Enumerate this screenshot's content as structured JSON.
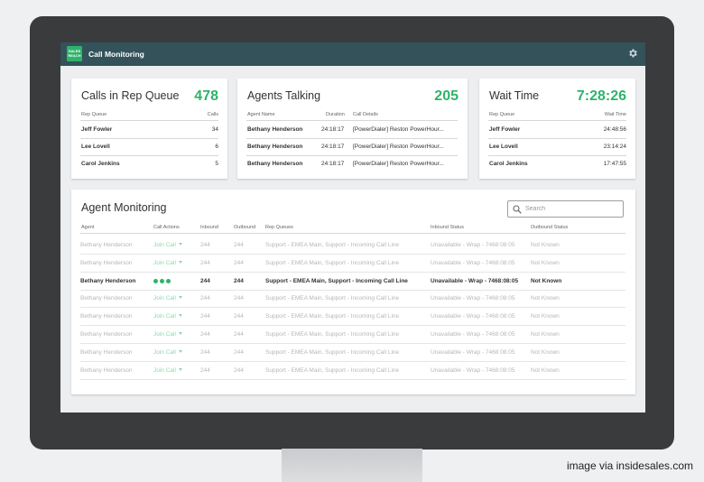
{
  "app": {
    "title": "Call Monitoring",
    "logo_text": "SALES\nREACH"
  },
  "caption": "image via insidesales.com",
  "rep_queue": {
    "title": "Calls in Rep Queue",
    "count": "478",
    "col_queue": "Rep Queue",
    "col_calls": "Calls",
    "rows": [
      {
        "name": "Jeff Fowler",
        "calls": "34"
      },
      {
        "name": "Lee Lovell",
        "calls": "6"
      },
      {
        "name": "Carol Jenkins",
        "calls": "5"
      }
    ]
  },
  "agents_talking": {
    "title": "Agents Talking",
    "count": "205",
    "col_agent": "Agent Name",
    "col_duration": "Duration",
    "col_details": "Call Details",
    "rows": [
      {
        "name": "Bethany Henderson",
        "duration": "24:18:17",
        "details": "[PowerDialer] Reston PowerHour..."
      },
      {
        "name": "Bethany Henderson",
        "duration": "24:18:17",
        "details": "[PowerDialer] Reston PowerHour..."
      },
      {
        "name": "Bethany Henderson",
        "duration": "24:18:17",
        "details": "[PowerDialer] Reston PowerHour..."
      }
    ]
  },
  "wait_time": {
    "title": "Wait Time",
    "value": "7:28:26",
    "col_queue": "Rep Queue",
    "col_wait": "Wait Time",
    "rows": [
      {
        "name": "Jeff Fowler",
        "wait": "24:48:56"
      },
      {
        "name": "Lee Lovell",
        "wait": "23:14:24"
      },
      {
        "name": "Carol Jenkins",
        "wait": "17:47:55"
      }
    ]
  },
  "agent_monitoring": {
    "title": "Agent Monitoring",
    "search_placeholder": "Search",
    "headers": {
      "agent": "Agent",
      "actions": "Call Actions",
      "inbound": "Inbound",
      "outbound": "Outbound",
      "queues": "Rep Queues",
      "in_status": "Inbound Status",
      "out_status": "Outbound Status"
    },
    "rows": [
      {
        "agent": "Bethany Henderson",
        "action": "Join Call",
        "inbound": "244",
        "outbound": "244",
        "queues": "Support - EMEA Main, Support - Incoming Call Line",
        "in_status": "Unavailable - Wrap - 7468:08:05",
        "out_status": "Not Known"
      },
      {
        "agent": "Bethany Henderson",
        "action": "Join Call",
        "inbound": "244",
        "outbound": "244",
        "queues": "Support - EMEA Main, Support - Incoming Call Line",
        "in_status": "Unavailable - Wrap - 7468:08:05",
        "out_status": "Not Known"
      },
      {
        "agent": "Bethany Henderson",
        "action": "",
        "inbound": "244",
        "outbound": "244",
        "queues": "Support - EMEA Main, Support - Incoming Call Line",
        "in_status": "Unavailable - Wrap - 7468:08:05",
        "out_status": "Not Known"
      },
      {
        "agent": "Bethany Henderson",
        "action": "Join Call",
        "inbound": "244",
        "outbound": "244",
        "queues": "Support - EMEA Main, Support - Incoming Call Line",
        "in_status": "Unavailable - Wrap - 7468:08:05",
        "out_status": "Not Known"
      },
      {
        "agent": "Bethany Henderson",
        "action": "Join Call",
        "inbound": "244",
        "outbound": "244",
        "queues": "Support - EMEA Main, Support - Incoming Call Line",
        "in_status": "Unavailable - Wrap - 7468:08:05",
        "out_status": "Not Known"
      },
      {
        "agent": "Bethany Henderson",
        "action": "Join Call",
        "inbound": "244",
        "outbound": "244",
        "queues": "Support - EMEA Main, Support - Incoming Call Line",
        "in_status": "Unavailable - Wrap - 7468:08:05",
        "out_status": "Not Known"
      },
      {
        "agent": "Bethany Henderson",
        "action": "Join Call",
        "inbound": "244",
        "outbound": "244",
        "queues": "Support - EMEA Main, Support - Incoming Call Line",
        "in_status": "Unavailable - Wrap - 7468:08:05",
        "out_status": "Not Known"
      },
      {
        "agent": "Bethany Henderson",
        "action": "Join Call",
        "inbound": "244",
        "outbound": "244",
        "queues": "Support - EMEA Main, Support - Incoming Call Line",
        "in_status": "Unavailable - Wrap - 7468:08:05",
        "out_status": "Not Known"
      }
    ]
  },
  "colors": {
    "accent": "#2fb36b",
    "appbar": "#33525a",
    "bezel": "#3a3b3d"
  },
  "icons": {
    "settings": "gear-icon",
    "search": "search-icon",
    "dropdown": "chevron-down-icon",
    "in_call": "dots-icon"
  }
}
